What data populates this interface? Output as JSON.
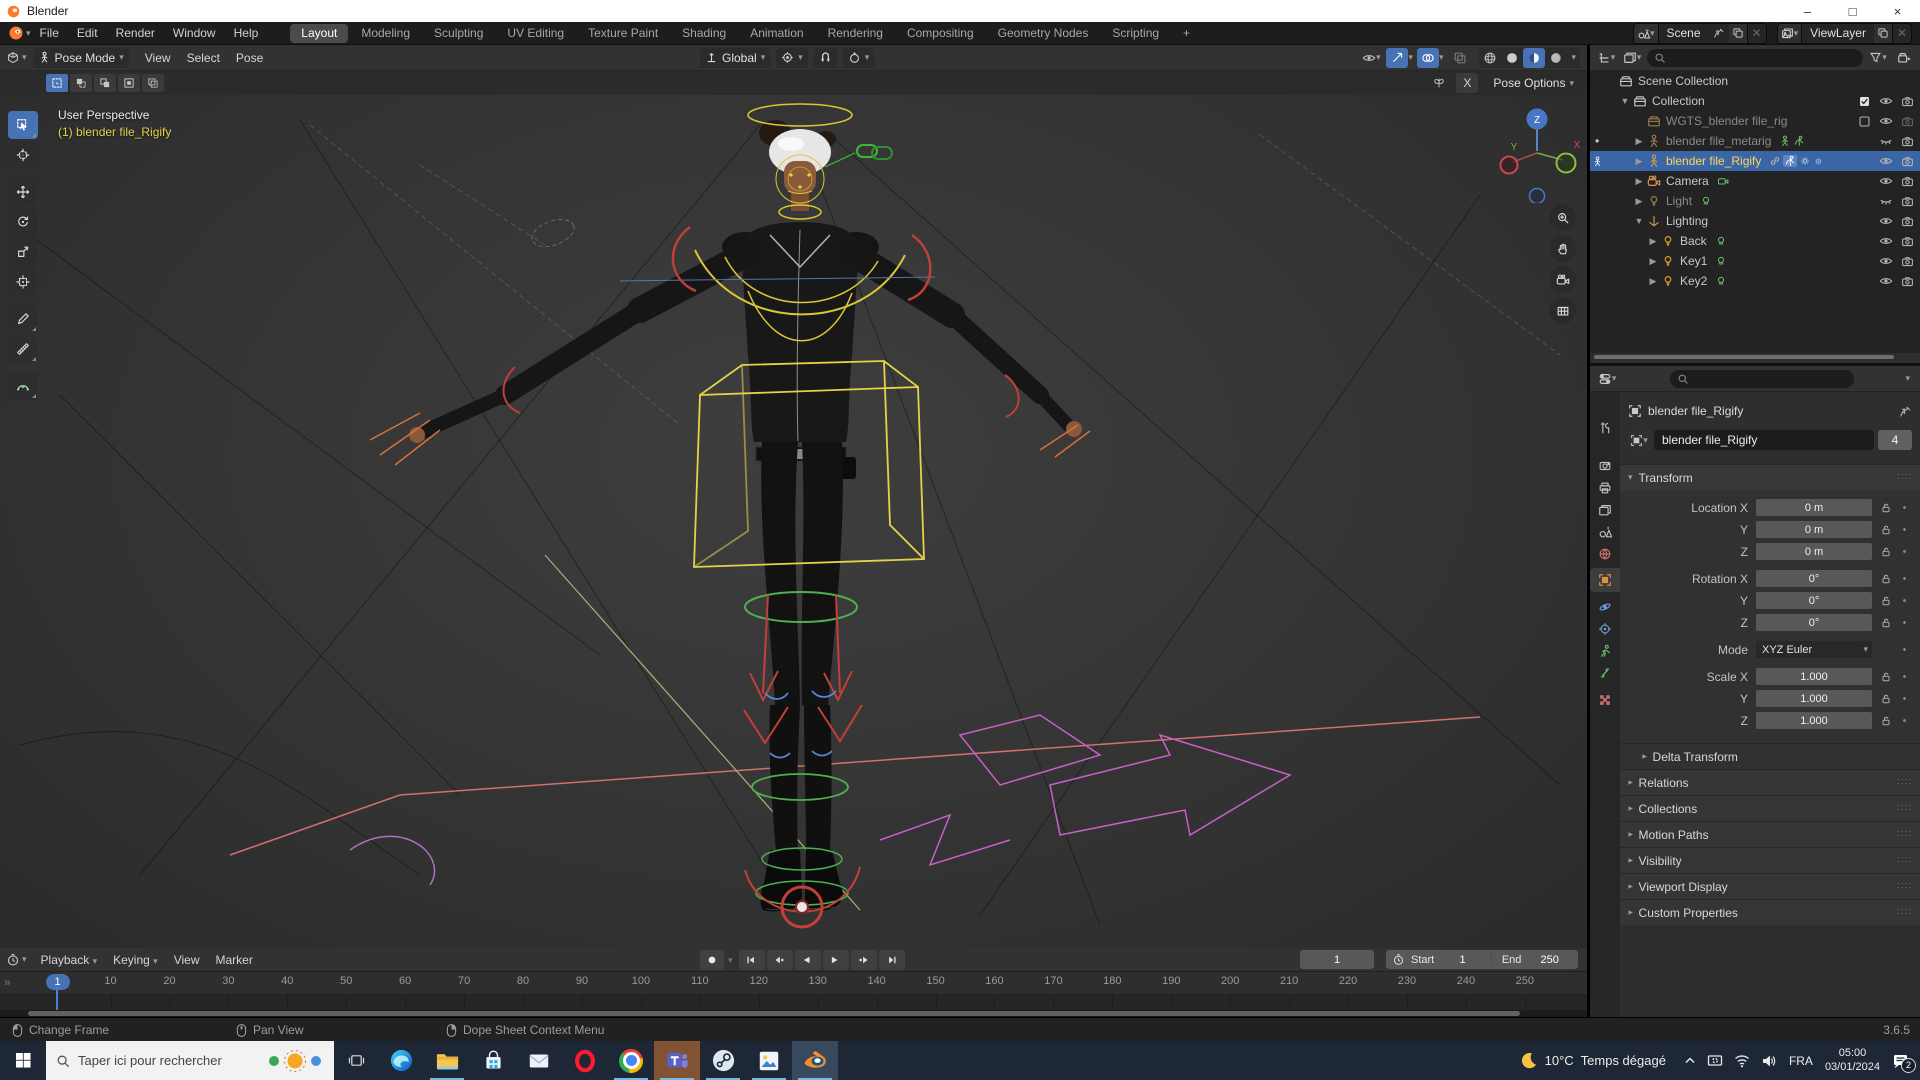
{
  "colors": {
    "accent": "#4772b3",
    "selection_bg": "#3a66a5",
    "active_object_text": "#ffd75c",
    "overlay_yellow": "#e3d24b"
  },
  "window": {
    "title": "Blender"
  },
  "topbar": {
    "menus": [
      "File",
      "Edit",
      "Render",
      "Window",
      "Help"
    ],
    "workspaces": [
      "Layout",
      "Modeling",
      "Sculpting",
      "UV Editing",
      "Texture Paint",
      "Shading",
      "Animation",
      "Rendering",
      "Compositing",
      "Geometry Nodes",
      "Scripting"
    ],
    "active_workspace": "Layout",
    "new_tab": "+",
    "scene_name": "Scene",
    "viewlayer_name": "ViewLayer"
  },
  "viewport": {
    "mode": "Pose Mode",
    "menus": [
      "View",
      "Select",
      "Pose"
    ],
    "orientation": "Global",
    "mirror_label": "X",
    "pose_options_label": "Pose Options",
    "overlay_line1": "User Perspective",
    "overlay_line2": "(1) blender file_Rigify",
    "gizmo": {
      "z": "Z",
      "y": "Y",
      "x": "X"
    },
    "tools": [
      "select-box",
      "cursor",
      "move",
      "rotate",
      "scale",
      "transform",
      "annotate",
      "measure",
      "pose-breakdowner"
    ],
    "active_tool": "select-box",
    "select_modes": [
      "new",
      "extend",
      "subtract",
      "invert",
      "intersect"
    ],
    "active_select_mode": "new",
    "nav_buttons": [
      "zoom",
      "pan",
      "camera-view",
      "toggle-ortho"
    ],
    "header_toggles": {
      "visibility": "on",
      "gizmos": "on",
      "overlays": "on",
      "xray": "off",
      "shading": [
        "wireframe",
        "solid",
        "material",
        "rendered"
      ],
      "shading_active": "material"
    }
  },
  "outliner": {
    "rows": [
      {
        "label": "Scene Collection",
        "icon": "collection",
        "level": 0,
        "caret": "none",
        "right": []
      },
      {
        "label": "Collection",
        "icon": "collection",
        "level": 1,
        "caret": "open",
        "right": [
          "checkbox-checked",
          "eye-open",
          "camera-render"
        ]
      },
      {
        "label": "WGTS_blender file_rig",
        "icon": "collection",
        "level": 2,
        "caret": "none",
        "dim": true,
        "right": [
          "checkbox-empty",
          "eye-open",
          "camera-render-dim"
        ]
      },
      {
        "label": "blender file_metarig",
        "icon": "armature",
        "level": 2,
        "caret": "closed",
        "dim": true,
        "gutter": "dot",
        "badges": [
          "armature-data",
          "armature-pose"
        ],
        "right": [
          "eye-closed",
          "camera-render"
        ]
      },
      {
        "label": "blender file_Rigify",
        "icon": "armature",
        "level": 2,
        "caret": "closed",
        "selected": true,
        "gutter": "active-armature",
        "badges": [
          "link",
          "pose-box",
          "gear",
          "mini"
        ],
        "right": [
          "eye-open",
          "camera-render"
        ]
      },
      {
        "label": "Camera",
        "icon": "camera-object",
        "level": 2,
        "caret": "closed",
        "badges": [
          "camera-data"
        ],
        "right": [
          "eye-open",
          "camera-render"
        ]
      },
      {
        "label": "Light",
        "icon": "light",
        "level": 2,
        "caret": "closed",
        "dim": true,
        "badges": [
          "light-data"
        ],
        "right": [
          "eye-closed",
          "camera-render"
        ]
      },
      {
        "label": "Lighting",
        "icon": "empty-axes",
        "level": 2,
        "caret": "open",
        "right": [
          "eye-open",
          "camera-render"
        ]
      },
      {
        "label": "Back",
        "icon": "light",
        "level": 3,
        "caret": "closed",
        "badges": [
          "light-data"
        ],
        "right": [
          "eye-open",
          "camera-render"
        ]
      },
      {
        "label": "Key1",
        "icon": "light",
        "level": 3,
        "caret": "closed",
        "badges": [
          "light-data"
        ],
        "right": [
          "eye-open",
          "camera-render"
        ]
      },
      {
        "label": "Key2",
        "icon": "light",
        "level": 3,
        "caret": "closed",
        "badges": [
          "light-data"
        ],
        "right": [
          "eye-open",
          "camera-render"
        ]
      }
    ]
  },
  "properties": {
    "tabs": [
      "tool",
      "render",
      "output",
      "view-layer",
      "scene",
      "world",
      "object",
      "physics",
      "constraints",
      "object-data",
      "bone",
      "texture"
    ],
    "active_tab": "object",
    "breadcrumb": "blender file_Rigify",
    "name_field": "blender file_Rigify",
    "users_count": "4",
    "transform": {
      "title": "Transform",
      "rows": [
        {
          "label": "Location X",
          "value": "0 m",
          "group": true
        },
        {
          "label": "Y",
          "value": "0 m"
        },
        {
          "label": "Z",
          "value": "0 m"
        },
        {
          "label": "Rotation X",
          "value": "0°",
          "group": true
        },
        {
          "label": "Y",
          "value": "0°"
        },
        {
          "label": "Z",
          "value": "0°"
        },
        {
          "label": "Mode",
          "value": "XYZ Euler",
          "type": "dropdown",
          "group": true
        },
        {
          "label": "Scale X",
          "value": "1.000",
          "group": true
        },
        {
          "label": "Y",
          "value": "1.000"
        },
        {
          "label": "Z",
          "value": "1.000"
        }
      ],
      "subsection": "Delta Transform"
    },
    "sections": [
      "Relations",
      "Collections",
      "Motion Paths",
      "Visibility",
      "Viewport Display",
      "Custom Properties"
    ]
  },
  "timeline": {
    "menus": [
      "Playback",
      "Keying",
      "View",
      "Marker"
    ],
    "current_frame": "1",
    "start_label": "Start",
    "start_value": "1",
    "end_label": "End",
    "end_value": "250",
    "ruler": [
      1,
      10,
      20,
      30,
      40,
      50,
      60,
      70,
      80,
      90,
      100,
      110,
      120,
      130,
      140,
      150,
      160,
      170,
      180,
      190,
      200,
      210,
      220,
      230,
      240,
      250
    ],
    "transport": [
      "jump-start",
      "prev-keyframe",
      "play-reverse",
      "play",
      "next-keyframe",
      "jump-end"
    ]
  },
  "statusbar": {
    "hints": [
      {
        "button": "left",
        "label": "Change Frame"
      },
      {
        "button": "middle",
        "label": "Pan View"
      },
      {
        "button": "right",
        "label": "Dope Sheet Context Menu"
      }
    ],
    "version": "3.6.5"
  },
  "taskbar": {
    "search_text": "Taper ici pour rechercher",
    "apps": [
      {
        "name": "edge"
      },
      {
        "name": "explorer",
        "running": true
      },
      {
        "name": "store"
      },
      {
        "name": "mail"
      },
      {
        "name": "opera"
      },
      {
        "name": "chrome",
        "running": true
      },
      {
        "name": "teams",
        "running": true,
        "highlight": "attention"
      },
      {
        "name": "steam",
        "running": true
      },
      {
        "name": "photos",
        "running": true
      },
      {
        "name": "blender",
        "running": true,
        "highlight": "active"
      }
    ],
    "weather": {
      "temp": "10°C",
      "desc": "Temps dégagé"
    },
    "tray": [
      "chevron-up",
      "monitor",
      "wifi",
      "volume"
    ],
    "language": "FRA",
    "time": "05:00",
    "date": "03/01/2024",
    "notification_count": "2"
  }
}
